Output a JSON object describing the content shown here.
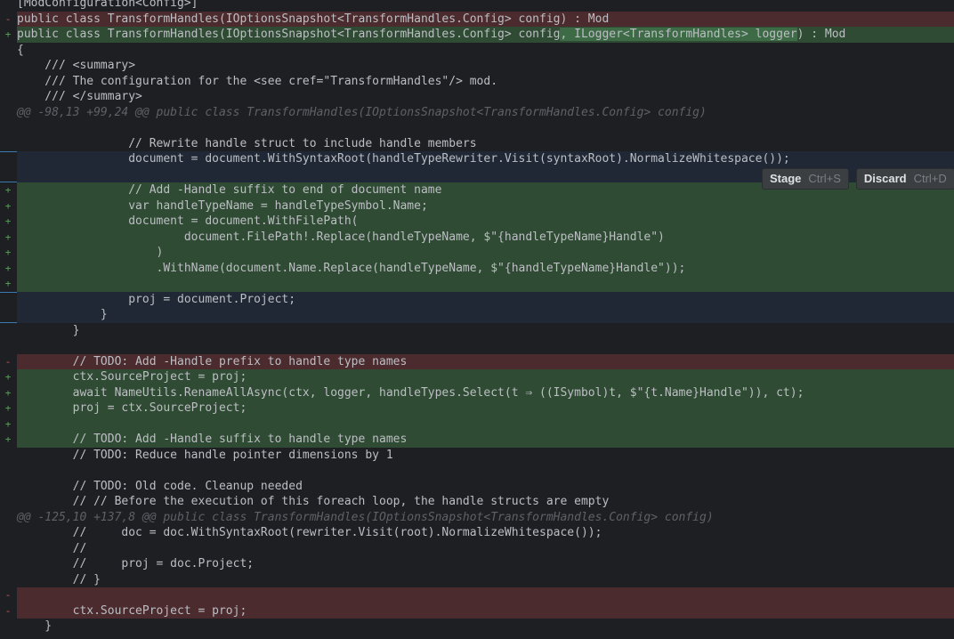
{
  "diff_lines": [
    {
      "type": "ctx",
      "marker": "",
      "text": "[ModConfiguration<Config>]"
    },
    {
      "type": "del",
      "marker": "-",
      "text": "public class TransformHandles(IOptionsSnapshot<TransformHandles.Config> config) : Mod"
    },
    {
      "type": "add",
      "marker": "+",
      "text": "public class TransformHandles(IOptionsSnapshot<TransformHandles.Config> config, ILogger<TransformHandles> logger) : Mod"
    },
    {
      "type": "ctx",
      "marker": "",
      "text": "{"
    },
    {
      "type": "ctx",
      "marker": "",
      "text": "    /// <summary>"
    },
    {
      "type": "ctx",
      "marker": "",
      "text": "    /// The configuration for the <see cref=\"TransformHandles\"/> mod."
    },
    {
      "type": "ctx",
      "marker": "",
      "text": "    /// </summary>"
    },
    {
      "type": "hunk",
      "marker": "",
      "text": "@@ -98,13 +99,24 @@ public class TransformHandles(IOptionsSnapshot<TransformHandles.Config> config)"
    },
    {
      "type": "ctx",
      "marker": "",
      "text": ""
    },
    {
      "type": "ctx",
      "marker": "",
      "text": "                // Rewrite handle struct to include handle members"
    },
    {
      "type": "sel",
      "marker": "",
      "text": "                document = document.WithSyntaxRoot(handleTypeRewriter.Visit(syntaxRoot).NormalizeWhitespace());"
    },
    {
      "type": "sel",
      "marker": "",
      "text": ""
    },
    {
      "type": "add",
      "marker": "+",
      "text": "                // Add -Handle suffix to end of document name"
    },
    {
      "type": "add",
      "marker": "+",
      "text": "                var handleTypeName = handleTypeSymbol.Name;"
    },
    {
      "type": "add",
      "marker": "+",
      "text": "                document = document.WithFilePath("
    },
    {
      "type": "add",
      "marker": "+",
      "text": "                        document.FilePath!.Replace(handleTypeName, $\"{handleTypeName}Handle\")"
    },
    {
      "type": "add",
      "marker": "+",
      "text": "                    )"
    },
    {
      "type": "add",
      "marker": "+",
      "text": "                    .WithName(document.Name.Replace(handleTypeName, $\"{handleTypeName}Handle\"));"
    },
    {
      "type": "add",
      "marker": "+",
      "text": ""
    },
    {
      "type": "sel",
      "marker": "",
      "text": "                proj = document.Project;"
    },
    {
      "type": "sel",
      "marker": "",
      "text": "            }"
    },
    {
      "type": "ctx",
      "marker": "",
      "text": "        }"
    },
    {
      "type": "ctx",
      "marker": "",
      "text": ""
    },
    {
      "type": "del",
      "marker": "-",
      "text": "        // TODO: Add -Handle prefix to handle type names"
    },
    {
      "type": "add",
      "marker": "+",
      "text": "        ctx.SourceProject = proj;"
    },
    {
      "type": "add",
      "marker": "+",
      "text": "        await NameUtils.RenameAllAsync(ctx, logger, handleTypes.Select(t ⇒ ((ISymbol)t, $\"{t.Name}Handle\")), ct);"
    },
    {
      "type": "add",
      "marker": "+",
      "text": "        proj = ctx.SourceProject;"
    },
    {
      "type": "add",
      "marker": "+",
      "text": ""
    },
    {
      "type": "add",
      "marker": "+",
      "text": "        // TODO: Add -Handle suffix to handle type names"
    },
    {
      "type": "ctx",
      "marker": "",
      "text": "        // TODO: Reduce handle pointer dimensions by 1"
    },
    {
      "type": "ctx",
      "marker": "",
      "text": ""
    },
    {
      "type": "ctx",
      "marker": "",
      "text": "        // TODO: Old code. Cleanup needed"
    },
    {
      "type": "ctx",
      "marker": "",
      "text": "        // // Before the execution of this foreach loop, the handle structs are empty"
    },
    {
      "type": "hunk",
      "marker": "",
      "text": "@@ -125,10 +137,8 @@ public class TransformHandles(IOptionsSnapshot<TransformHandles.Config> config)"
    },
    {
      "type": "ctx",
      "marker": "",
      "text": "        //     doc = doc.WithSyntaxRoot(rewriter.Visit(root).NormalizeWhitespace());"
    },
    {
      "type": "ctx",
      "marker": "",
      "text": "        //"
    },
    {
      "type": "ctx",
      "marker": "",
      "text": "        //     proj = doc.Project;"
    },
    {
      "type": "ctx",
      "marker": "",
      "text": "        // }"
    },
    {
      "type": "del",
      "marker": "-",
      "text": ""
    },
    {
      "type": "del",
      "marker": "-",
      "text": "        ctx.SourceProject = proj;"
    },
    {
      "type": "ctx",
      "marker": "",
      "text": "    }"
    }
  ],
  "inline_highlight": {
    "text": ", ILogger<TransformHandles> logger"
  },
  "actions": {
    "stage_label": "Stage",
    "stage_shortcut": "Ctrl+S",
    "discard_label": "Discard",
    "discard_shortcut": "Ctrl+D"
  },
  "colors": {
    "background": "#1e1f22",
    "added": "#2f4b33",
    "deleted": "#4b2b2d",
    "selection_border": "#3a7ab0"
  }
}
